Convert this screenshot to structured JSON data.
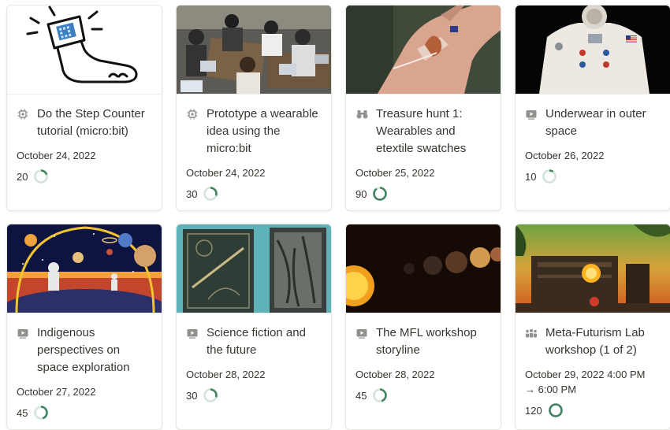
{
  "cards": [
    {
      "title": "Do the Step Counter tutorial (micro:bit)",
      "icon": "chip-icon",
      "date": "October 24, 2022",
      "count": "20",
      "progress": 0.2,
      "cover": "step-counter-illustration"
    },
    {
      "title": "Prototype a wearable idea using the micro:bit",
      "icon": "chip-icon",
      "date": "October 24, 2022",
      "count": "30",
      "progress": 0.3,
      "cover": "classroom-photo"
    },
    {
      "title": "Treasure hunt 1: Wearables and etextile swatches",
      "icon": "binoculars-icon",
      "date": "October 25, 2022",
      "count": "90",
      "progress": 0.9,
      "cover": "hand-etextile-photo"
    },
    {
      "title": "Underwear in outer space",
      "icon": "video-icon",
      "date": "October 26, 2022",
      "count": "10",
      "progress": 0.1,
      "cover": "spacesuit-photo"
    },
    {
      "title": "Indigenous perspectives on space exploration",
      "icon": "video-icon",
      "date": "October 27, 2022",
      "count": "45",
      "progress": 0.45,
      "cover": "space-art"
    },
    {
      "title": "Science fiction and the future",
      "icon": "video-icon",
      "date": "October 28, 2022",
      "count": "30",
      "progress": 0.3,
      "cover": "old-books-photo"
    },
    {
      "title": "The MFL workshop storyline",
      "icon": "video-icon",
      "date": "October 28, 2022",
      "count": "45",
      "progress": 0.45,
      "cover": "planets-photo"
    },
    {
      "title": "Meta-Futurism Lab workshop (1 of 2)",
      "icon": "people-icon",
      "date": "October 29, 2022 4:00 PM",
      "date2": "→ 6:00 PM",
      "count": "120",
      "progress": 1.0,
      "cover": "future-city-photo"
    }
  ],
  "colors": {
    "ring_fill": "#448361",
    "ring_track": "#d3e5db",
    "icon": "#91918e"
  }
}
